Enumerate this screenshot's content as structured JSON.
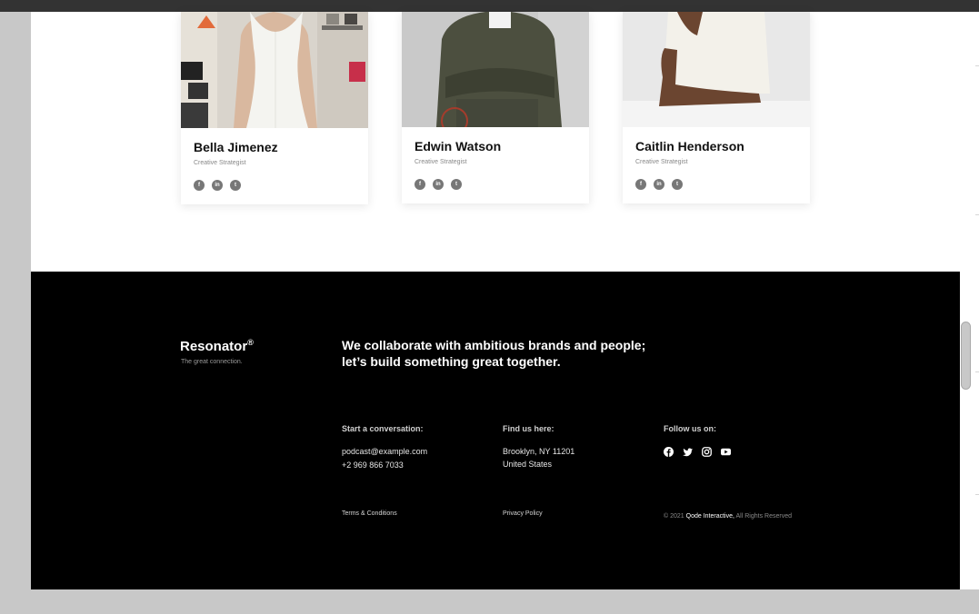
{
  "team": [
    {
      "name": "Bella Jimenez",
      "role": "Creative Strategist",
      "socials": [
        "facebook-icon",
        "linkedin-icon",
        "twitter-icon"
      ]
    },
    {
      "name": "Edwin Watson",
      "role": "Creative Strategist",
      "socials": [
        "facebook-icon",
        "linkedin-icon",
        "twitter-icon"
      ]
    },
    {
      "name": "Caitlin Henderson",
      "role": "Creative Strategist",
      "socials": [
        "facebook-icon",
        "linkedin-icon",
        "twitter-icon"
      ]
    }
  ],
  "footer": {
    "brand": "Resonator",
    "brand_mark": "®",
    "tagline": "The great connection.",
    "headline_line1": "We collaborate with ambitious brands and people;",
    "headline_line2": "let’s build something great together.",
    "contact": {
      "title": "Start a conversation:",
      "email": "podcast@example.com",
      "phone": "+2 969 866 7033"
    },
    "location": {
      "title": "Find us here:",
      "line1": "Brooklyn, NY 11201",
      "line2": "United States"
    },
    "follow": {
      "title": "Follow us on:",
      "icons": [
        "facebook-icon",
        "twitter-icon",
        "instagram-icon",
        "youtube-icon"
      ]
    },
    "terms": "Terms & Conditions",
    "privacy": "Privacy Policy",
    "copyright_prefix": "© 2021",
    "copyright_company": "Qode Interactive,",
    "copyright_suffix": "All Rights Reserved"
  },
  "colors": {
    "footer_bg": "#000000",
    "page_bg": "#ffffff",
    "browser_bg": "#c8c8c8"
  }
}
